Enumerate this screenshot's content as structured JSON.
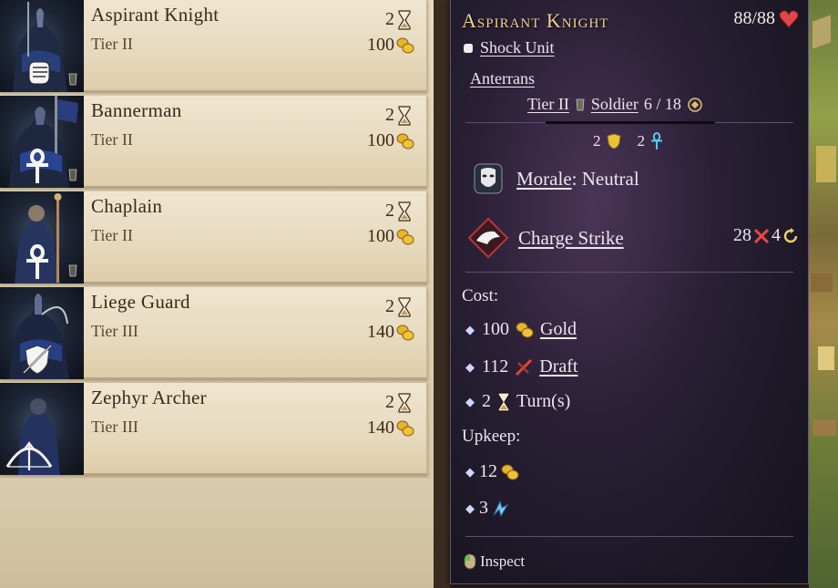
{
  "units": [
    {
      "name": "Aspirant Knight",
      "tier": "Tier II",
      "turns": "2",
      "cost": "100",
      "role_icon": "fist-icon"
    },
    {
      "name": "Bannerman",
      "tier": "Tier II",
      "turns": "2",
      "cost": "100",
      "role_icon": "ankh-icon"
    },
    {
      "name": "Chaplain",
      "tier": "Tier II",
      "turns": "2",
      "cost": "100",
      "role_icon": "ankh-icon"
    },
    {
      "name": "Liege Guard",
      "tier": "Tier III",
      "turns": "2",
      "cost": "140",
      "role_icon": "shield-sword-icon"
    },
    {
      "name": "Zephyr Archer",
      "tier": "Tier III",
      "turns": "2",
      "cost": "140",
      "role_icon": "bow-icon"
    }
  ],
  "tooltip": {
    "title": "Aspirant Knight",
    "hp": "88/88",
    "unit_class": "Shock Unit",
    "faction": "Anterrans",
    "tier": "Tier II",
    "unit_type": "Soldier",
    "count": "6 / 18",
    "defense": "2",
    "resistance": "2",
    "morale_label": "Morale",
    "morale_value": ": Neutral",
    "ability": "Charge Strike",
    "ability_damage": "28",
    "ability_cooldown": "4",
    "cost_label": "Cost:",
    "cost_gold": "100",
    "gold_label": "Gold",
    "cost_draft": "112",
    "draft_label": "Draft",
    "cost_turns": "2",
    "turns_label": "Turn(s)",
    "upkeep_label": "Upkeep:",
    "upkeep_gold": "12",
    "upkeep_mana": "3",
    "inspect": "Inspect"
  },
  "colors": {
    "title_gold": "#f0d28a",
    "parchment": "#e6d9bd",
    "tooltip_bg": "#2a2036",
    "heart_red": "#e0464a"
  }
}
